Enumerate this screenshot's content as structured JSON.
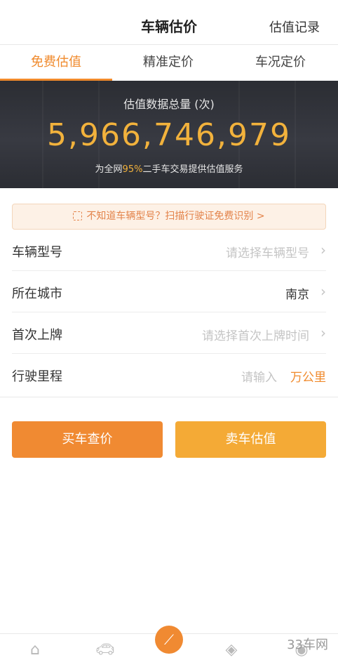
{
  "header": {
    "title": "车辆估价",
    "record_link": "估值记录"
  },
  "tabs": [
    {
      "label": "免费估值",
      "active": true
    },
    {
      "label": "精准定价",
      "active": false
    },
    {
      "label": "车况定价",
      "active": false
    }
  ],
  "banner": {
    "label": "估值数据总量 (次)",
    "total": "5,966,746,979",
    "sub_prefix": "为全网",
    "sub_pct": "95%",
    "sub_suffix": "二手车交易提供估值服务"
  },
  "scan_tip": {
    "text": "不知道车辆型号？扫描行驶证免费识别 >",
    "icon": "scan-icon"
  },
  "form": {
    "model": {
      "label": "车辆型号",
      "placeholder": "请选择车辆型号"
    },
    "city": {
      "label": "所在城市",
      "value": "南京"
    },
    "first_reg": {
      "label": "首次上牌",
      "placeholder": "请选择首次上牌时间"
    },
    "mileage": {
      "label": "行驶里程",
      "placeholder": "请输入",
      "unit": "万公里"
    }
  },
  "buttons": {
    "buy": "买车查价",
    "sell": "卖车估值"
  },
  "tabbar": {
    "icons": [
      "home-icon",
      "car-icon",
      "chart-icon",
      "tag-icon",
      "profile-icon"
    ]
  },
  "watermark": "33车网",
  "colors": {
    "accent": "#f08a2c",
    "gold": "#f2b23c",
    "banner_bg": "#2b2d33"
  }
}
